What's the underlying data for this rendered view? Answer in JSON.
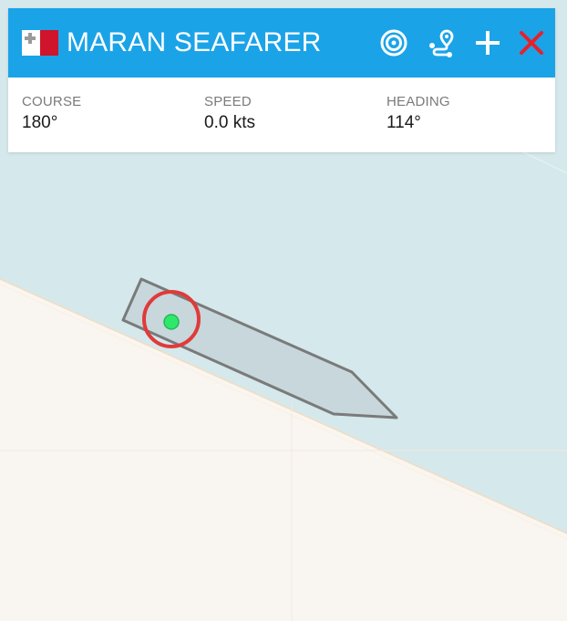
{
  "vessel": {
    "name": "MARAN SEAFARER",
    "flag": "Malta"
  },
  "header_actions": [
    {
      "name": "track-target-icon"
    },
    {
      "name": "route-icon"
    },
    {
      "name": "add-icon"
    },
    {
      "name": "close-icon"
    }
  ],
  "stats": {
    "course": {
      "label": "COURSE",
      "value": "180°"
    },
    "speed": {
      "label": "SPEED",
      "value": "0.0 kts"
    },
    "heading": {
      "label": "HEADING",
      "value": "114°"
    }
  },
  "colors": {
    "header": "#1ba3e8",
    "water": "#d5e8ec",
    "land": "#f9f6f1",
    "vessel_fill": "#c5d5da",
    "vessel_outline": "#7a7a7a",
    "position_dot": "#2ee86b",
    "selection_ring": "#e03a3a",
    "close": "#e8202a"
  }
}
